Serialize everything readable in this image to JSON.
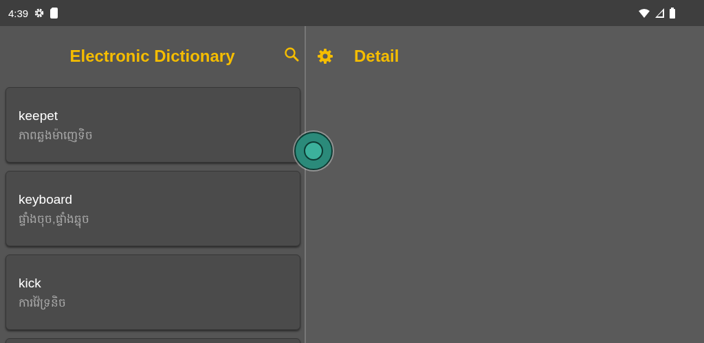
{
  "status_bar": {
    "time": "4:39"
  },
  "list_pane": {
    "title": "Electronic Dictionary"
  },
  "entries": [
    {
      "word": "keepet",
      "translation": "ភាពឆ្លងម៉ាញេទិច"
    },
    {
      "word": "keyboard",
      "translation": "ផ្ទាំងចុច,ផ្ទាំងឆ្នុច"
    },
    {
      "word": "kick",
      "translation": "ការវ៉ៃទ្រនិច"
    }
  ],
  "more_entries_below": true,
  "detail_pane": {
    "title": "Detail"
  }
}
